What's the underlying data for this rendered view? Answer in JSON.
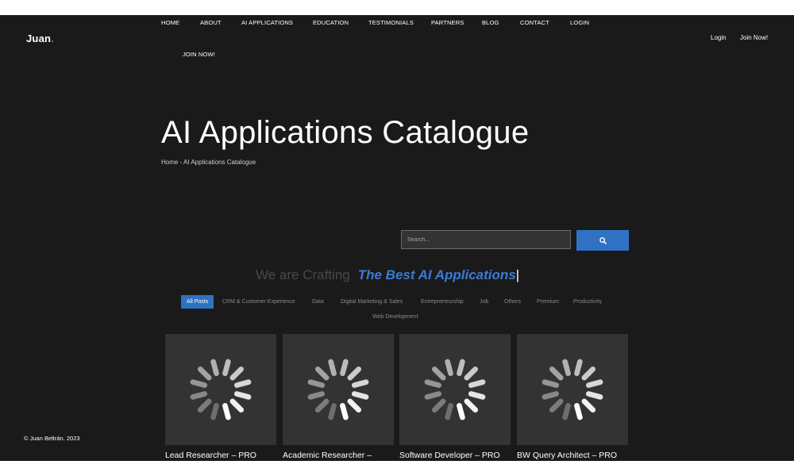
{
  "brand": {
    "logo_text": "Juan",
    "logo_dot": "."
  },
  "nav": {
    "items": [
      "HOME",
      "ABOUT",
      "AI APPLICATIONS",
      "EDUCATION",
      "TESTIMONIALS",
      "PARTNERS",
      "BLOG",
      "CONTACT",
      "LOGIN"
    ],
    "join_now": "JOIN NOW!"
  },
  "header_right": {
    "login": "Login",
    "join_now": "Join Now!"
  },
  "hero": {
    "title": "AI Applications Catalogue",
    "breadcrumb": "Home - AI Applications Catalogue"
  },
  "search": {
    "placeholder": "Search...",
    "button_icon": "search-icon"
  },
  "tagline": {
    "muted": "We are Crafting",
    "accent": "The Best AI Applications",
    "caret": "|"
  },
  "filters": {
    "items": [
      "All Posts",
      "CRM & Customer Experience",
      "Data",
      "Digital Marketing & Sales",
      "Entrepreneurship",
      "Job",
      "Others",
      "Premium",
      "Productivity",
      "Web Development"
    ],
    "active": "All Posts"
  },
  "cards": [
    {
      "title": "Lead Researcher – PRO"
    },
    {
      "title": "Academic Researcher –"
    },
    {
      "title": "Software Developer – PRO"
    },
    {
      "title": "BW Query Architect – PRO"
    }
  ],
  "footer": {
    "copyright": "© Juan Beltrán. 2023"
  },
  "colors": {
    "background": "#1a1a1a",
    "accent": "#3a7bd5",
    "button": "#2f72c4",
    "card": "#333333"
  }
}
